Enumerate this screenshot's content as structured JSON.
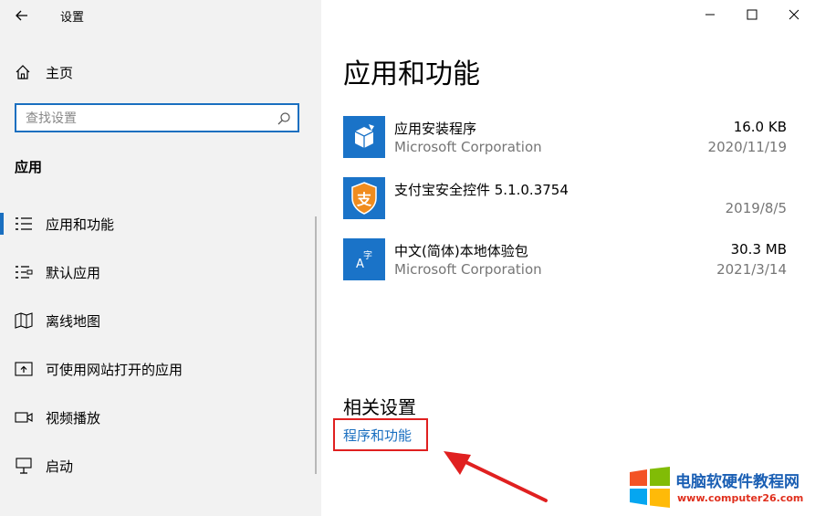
{
  "window": {
    "title": "设置"
  },
  "sidebar": {
    "home_label": "主页",
    "search_placeholder": "查找设置",
    "section_label": "应用",
    "items": [
      {
        "label": "应用和功能",
        "icon": "apps-features-icon",
        "active": true
      },
      {
        "label": "默认应用",
        "icon": "default-apps-icon",
        "active": false
      },
      {
        "label": "离线地图",
        "icon": "offline-maps-icon",
        "active": false
      },
      {
        "label": "可使用网站打开的应用",
        "icon": "apps-for-websites-icon",
        "active": false
      },
      {
        "label": "视频播放",
        "icon": "video-playback-icon",
        "active": false
      },
      {
        "label": "启动",
        "icon": "startup-icon",
        "active": false
      }
    ]
  },
  "main": {
    "title": "应用和功能",
    "apps": [
      {
        "name": "应用安装程序",
        "publisher": "Microsoft Corporation",
        "size": "16.0 KB",
        "date": "2020/11/19",
        "icon": "app-installer-icon",
        "icon_color": "#1a73c8"
      },
      {
        "name": "支付宝安全控件 5.1.0.3754",
        "publisher": "",
        "size": "",
        "date": "2019/8/5",
        "icon": "alipay-security-icon",
        "icon_color": "#1a73c8"
      },
      {
        "name": "中文(简体)本地体验包",
        "publisher": "Microsoft Corporation",
        "size": "30.3 MB",
        "date": "2021/3/14",
        "icon": "chinese-language-pack-icon",
        "icon_color": "#1a73c8"
      }
    ],
    "related_title": "相关设置",
    "related_link": "程序和功能"
  },
  "watermark": {
    "name": "电脑软硬件教程网",
    "url": "www.computer26.com"
  },
  "colors": {
    "accent": "#1a6fc0",
    "sidebar_bg": "#f2f2f2",
    "annotation_red": "#e02020"
  }
}
